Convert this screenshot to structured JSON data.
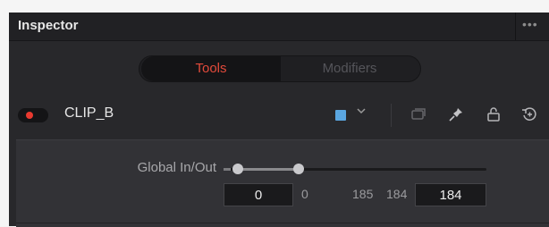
{
  "inspector": {
    "title": "Inspector",
    "more_label": "•••"
  },
  "tabs": [
    {
      "label": "Tools",
      "active": true
    },
    {
      "label": "Modifiers",
      "active": false
    }
  ],
  "clip": {
    "name": "CLIP_B",
    "enabled": true,
    "color": "#5aa6e0"
  },
  "toolbar_icons": [
    "clip-color-swatch",
    "chevron-down-icon",
    "versions-icon",
    "pin-icon",
    "lock-icon",
    "reset-icon"
  ],
  "global_in_out": {
    "label": "Global In/Out",
    "in_value": "0",
    "min_readout": "0",
    "max_readout": "185",
    "end_readout": "184",
    "out_value": "184"
  },
  "colors": {
    "accent_red": "#e24a3b",
    "toggle_red": "#e8392f",
    "panel_bg": "#28282b",
    "header_bg": "#212124"
  }
}
